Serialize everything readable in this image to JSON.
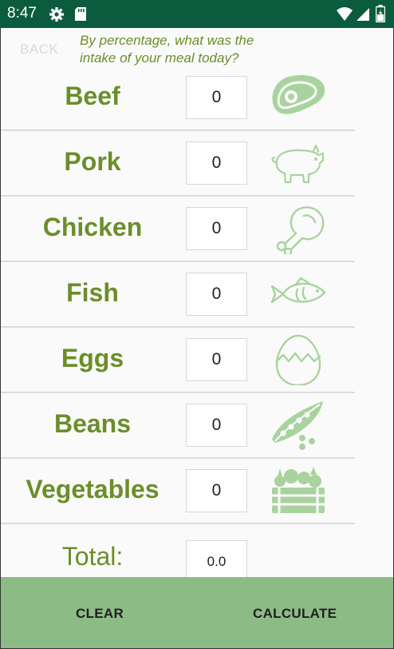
{
  "status_bar": {
    "time": "8:47",
    "icons": [
      "gear-icon",
      "sd-card-icon",
      "wifi-icon",
      "signal-icon",
      "battery-icon"
    ]
  },
  "header": {
    "back_label": "BACK",
    "question": "By percentage, what was the intake of your meal today?"
  },
  "rows": [
    {
      "label": "Beef",
      "value": "0",
      "icon": "steak-icon"
    },
    {
      "label": "Pork",
      "value": "0",
      "icon": "pig-icon"
    },
    {
      "label": "Chicken",
      "value": "0",
      "icon": "drumstick-icon"
    },
    {
      "label": "Fish",
      "value": "0",
      "icon": "fish-icon"
    },
    {
      "label": "Eggs",
      "value": "0",
      "icon": "egg-icon"
    },
    {
      "label": "Beans",
      "value": "0",
      "icon": "peas-icon"
    },
    {
      "label": "Vegetables",
      "value": "0",
      "icon": "vegetable-crate-icon"
    }
  ],
  "total": {
    "label": "Total:",
    "value": "0.0"
  },
  "actions": {
    "clear_label": "CLEAR",
    "calculate_label": "CALCULATE"
  },
  "colors": {
    "status_bar": "#0b5c3e",
    "accent_text": "#6b8e2a",
    "icon_stroke": "#a9d39e",
    "bottom_bar": "#8dbb86"
  }
}
